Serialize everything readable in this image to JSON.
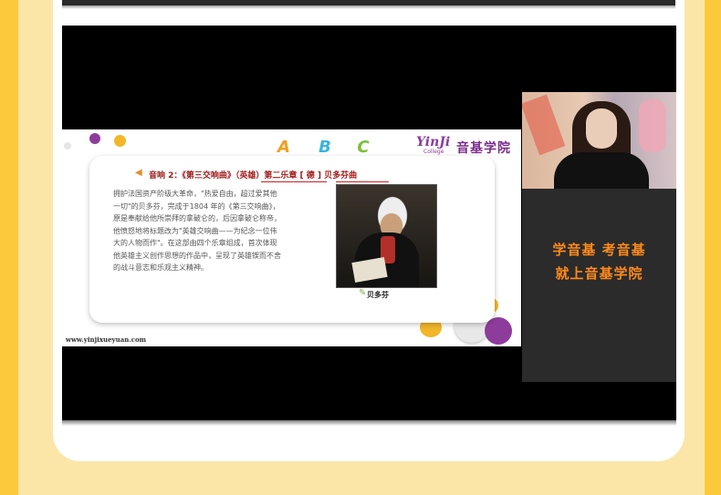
{
  "colors": {
    "page_bg": "#fbe6a8",
    "side_accent": "#fbc93b",
    "card_bg": "#ffffff",
    "promo_text": "#ff8a1a",
    "heading_red": "#a21b1b",
    "brand_purple": "#7a2c8c"
  },
  "slide": {
    "logo_mark": "YinJi",
    "logo_sub": "College",
    "logo_name": "音基学院",
    "abc_letters": [
      "A",
      "B",
      "C"
    ],
    "heading": "音响 2：《第三交响曲》（英雄）第二乐章 [ 德 ] 贝多芬曲",
    "body_lines": [
      "拥护法国资产阶级大革命，\"热爱自由，超过爱其他",
      "一切\"的贝多芬，完成于1804 年的《第三交响曲》，",
      "原是奉献给他所崇拜的拿破仑的，后因拿破仑称帝，",
      "他愤怒地将标题改为\"英雄交响曲——为纪念一位伟",
      "大的人物而作\"。在这部由四个乐章组成，首次体现",
      "他英雄主义创作思想的作品中，呈现了英雄锲而不舍",
      "的战斗意志和乐观主义精神。"
    ],
    "portrait_caption": "贝多芬",
    "url": "www.yinjixueyuan.com"
  },
  "webcam": {
    "icon": "presenter-webcam"
  },
  "promo": {
    "line1": "学音基 考音基",
    "line2": "就上音基学院"
  }
}
